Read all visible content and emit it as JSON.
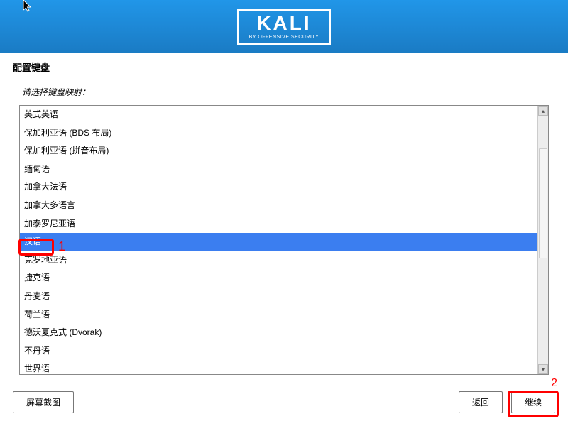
{
  "logo": {
    "main": "KALI",
    "sub": "BY OFFENSIVE SECURITY"
  },
  "title": "配置键盘",
  "prompt": "请选择键盘映射：",
  "items": [
    "英式英语",
    "保加利亚语 (BDS 布局)",
    "保加利亚语 (拼音布局)",
    "缅甸语",
    "加拿大法语",
    "加拿大多语言",
    "加泰罗尼亚语",
    "汉语",
    "克罗地亚语",
    "捷克语",
    "丹麦语",
    "荷兰语",
    "德沃夏克式 (Dvorak)",
    "不丹语",
    "世界语"
  ],
  "selected_index": 7,
  "buttons": {
    "screenshot": "屏幕截图",
    "back": "返回",
    "continue": "继续"
  },
  "annotations": {
    "a1": "1",
    "a2": "2"
  }
}
